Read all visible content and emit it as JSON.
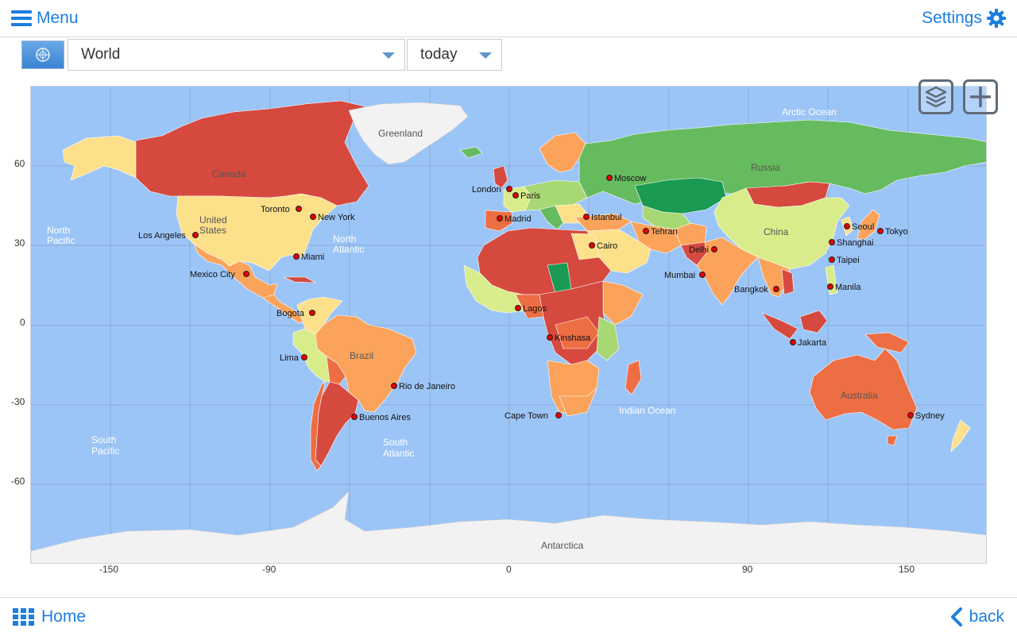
{
  "header": {
    "menu_label": "Menu",
    "settings_label": "Settings"
  },
  "toolbar": {
    "region": "World",
    "period": "today"
  },
  "footer": {
    "home_label": "Home",
    "back_label": "back"
  },
  "axes": {
    "x_ticks": [
      "-150",
      "-90",
      "0",
      "90",
      "150"
    ],
    "y_ticks": [
      "60",
      "30",
      "0",
      "-30",
      "-60"
    ]
  },
  "labels": {
    "regions": [
      "Canada",
      "Russia",
      "China",
      "Brazil",
      "Australia",
      "Greenland",
      "Antarctica"
    ],
    "united_states_1": "United",
    "united_states_2": "States",
    "oceans": [
      "Arctic Ocean",
      "Indian Ocean"
    ],
    "north_pacific": [
      "North",
      "Pacific"
    ],
    "north_atlantic": [
      "North",
      "Atlantic"
    ],
    "south_pacific": [
      "South",
      "Pacific"
    ],
    "south_atlantic": [
      "South",
      "Atlantic"
    ]
  },
  "cities": [
    "Moscow",
    "London",
    "Paris",
    "Madrid",
    "Istanbul",
    "Cairo",
    "Tehran",
    "Delhi",
    "Mumbai",
    "Bangkok",
    "Seoul",
    "Tokyo",
    "Shanghai",
    "Taipei",
    "Manila",
    "Jakarta",
    "Sydney",
    "Lagos",
    "Kinshasa",
    "Cape Town",
    "Toronto",
    "New York",
    "Los Angeles",
    "Miami",
    "Mexico City",
    "Bogota",
    "Lima",
    "Rio de Janeiro",
    "Buenos Aires"
  ],
  "colors": {
    "ocean": "#9cc5f7",
    "accent": "#1a7fe0",
    "very_high": "#d6493f",
    "high": "#ee6e43",
    "elevated": "#fba35b",
    "moderate": "#fde08a",
    "low": "#d9ec8b",
    "very_low": "#a8d874",
    "minimal": "#67bb5f",
    "lowest": "#1a9a52",
    "ice": "#f2f2f2"
  },
  "icons": {
    "menu": "hamburger-icon",
    "settings": "gear-icon",
    "home": "grid-icon",
    "back": "chevron-left-icon",
    "layers": "layers-icon",
    "zoom": "plus-icon",
    "flag": "un-flag-icon"
  }
}
